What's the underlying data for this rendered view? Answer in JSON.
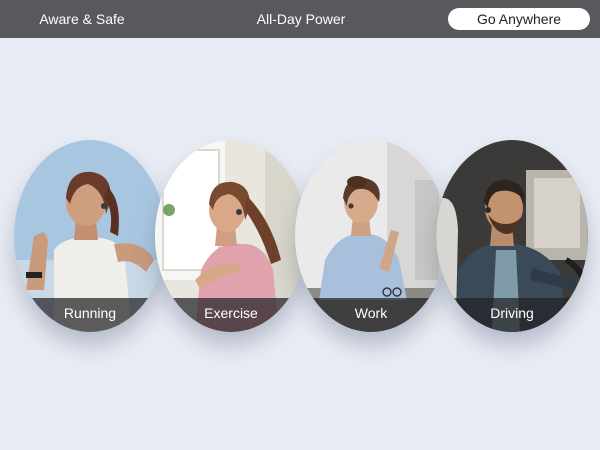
{
  "nav": {
    "tabs": [
      {
        "label": "Aware & Safe",
        "active": false
      },
      {
        "label": "All-Day Power",
        "active": false
      },
      {
        "label": "Go Anywhere",
        "active": true
      }
    ]
  },
  "cards": [
    {
      "label": "Running"
    },
    {
      "label": "Exercise"
    },
    {
      "label": "Work"
    },
    {
      "label": "Driving"
    }
  ],
  "colors": {
    "topbar": "#58595d",
    "background": "#e8ecf4",
    "active_tab": "#ffffff"
  }
}
